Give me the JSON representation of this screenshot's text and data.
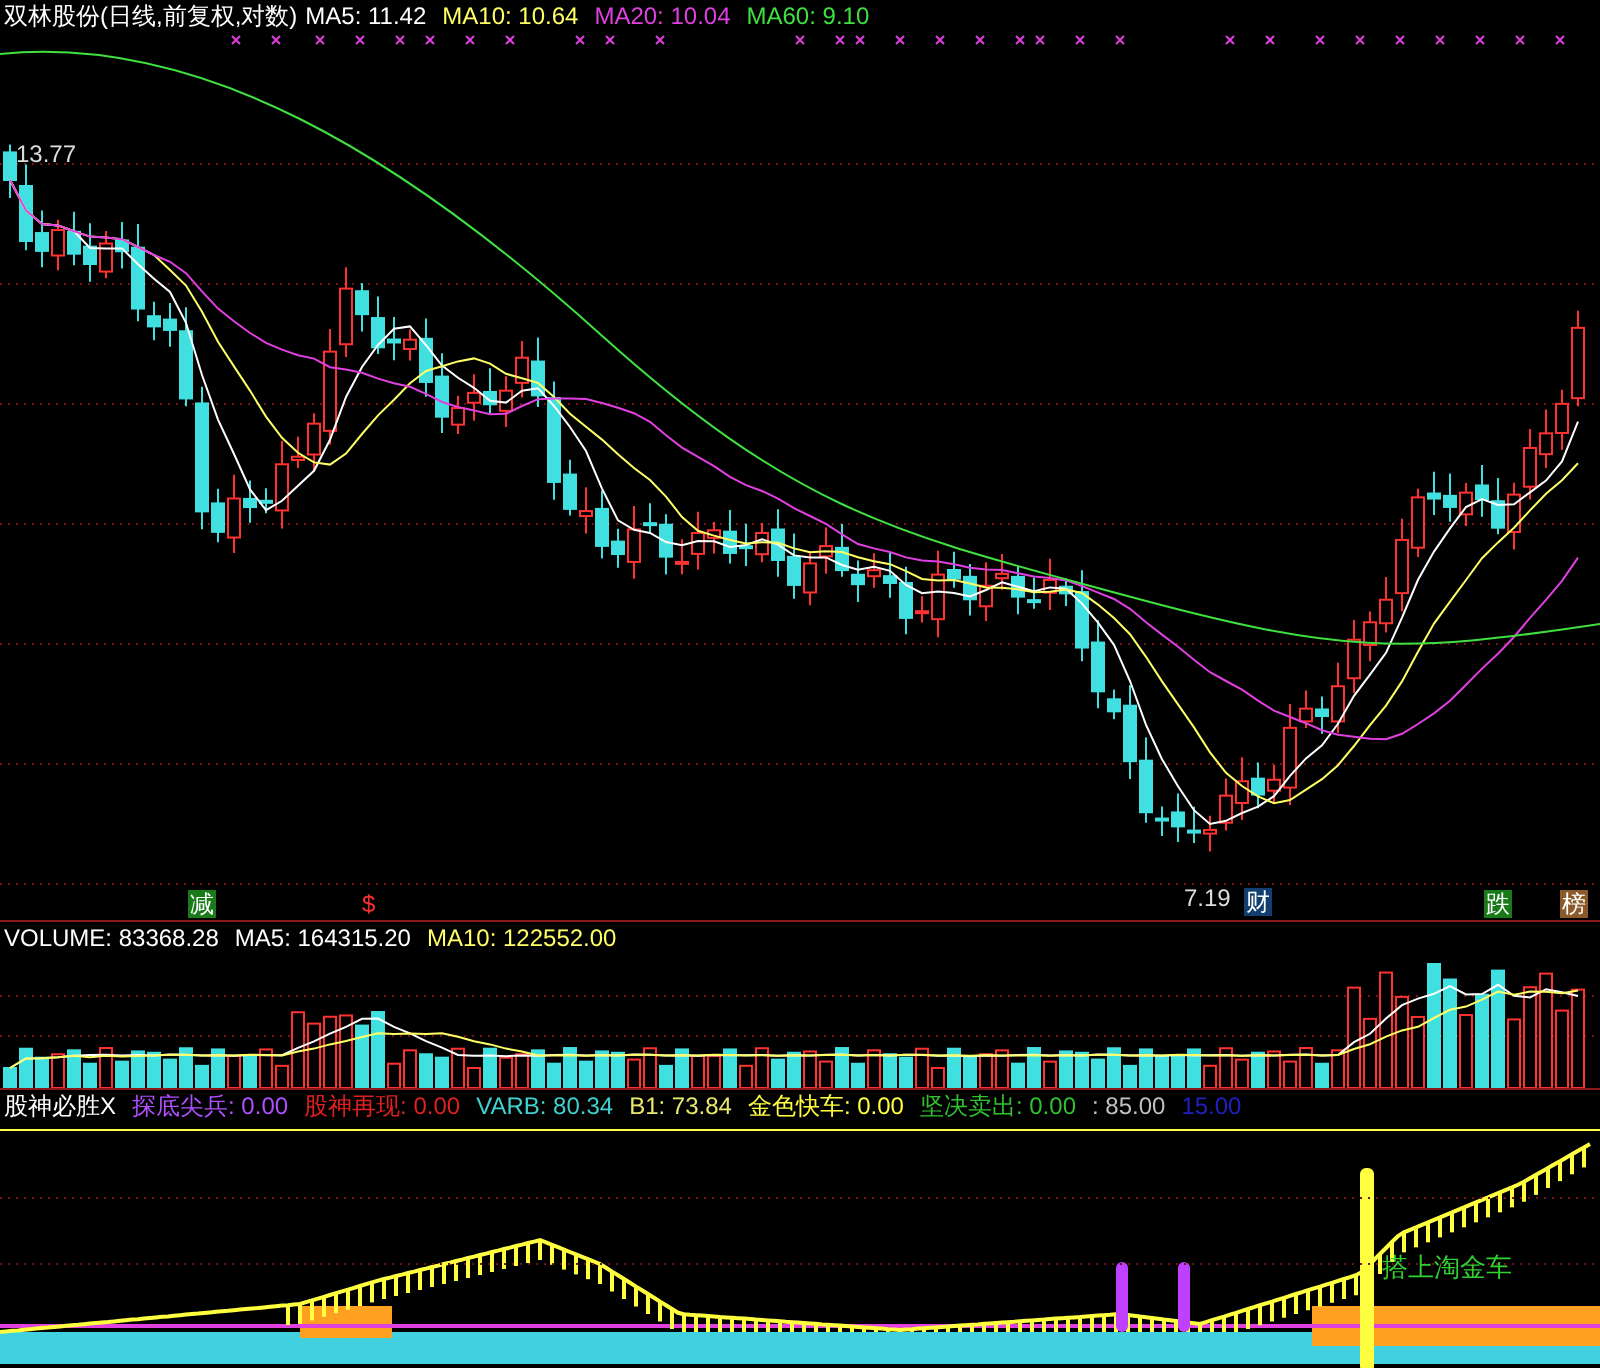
{
  "main_chart": {
    "title": "双林股份(日线,前复权,对数)",
    "indicators": [
      {
        "text": "MA5: 11.42",
        "color": "#ffffff"
      },
      {
        "text": "MA10: 10.64",
        "color": "#ffff66"
      },
      {
        "text": "MA20: 10.04",
        "color": "#e040e0"
      },
      {
        "text": "MA60: 9.10",
        "color": "#40e040"
      }
    ],
    "high_label": "13.77",
    "low_label": "7.19",
    "markers": [
      {
        "text": "减",
        "color": "#1a7a1a"
      },
      {
        "text": "$",
        "color": "#000000"
      },
      {
        "text": "财",
        "color": "#123e70"
      },
      {
        "text": "跌",
        "color": "#1a7a1a"
      },
      {
        "text": "榜",
        "color": "#8a5a2a"
      }
    ]
  },
  "volume_chart": {
    "indicators": [
      {
        "text": "VOLUME: 83368.28",
        "color": "#ffffff"
      },
      {
        "text": "MA5: 164315.20",
        "color": "#ffffff"
      },
      {
        "text": "MA10: 122552.00",
        "color": "#ffff66"
      }
    ]
  },
  "signal_chart": {
    "indicators": [
      {
        "text": "股神必胜X",
        "color": "#ffffff"
      },
      {
        "text": "探底尖兵: 0.00",
        "color": "#b050ff"
      },
      {
        "text": "股神再现: 0.00",
        "color": "#e02020"
      },
      {
        "text": "VARB: 80.34",
        "color": "#40d0d0"
      },
      {
        "text": "B1: 73.84",
        "color": "#e8e870"
      },
      {
        "text": "金色快车: 0.00",
        "color": "#ffff40"
      },
      {
        "text": "坚决卖出: 0.00",
        "color": "#30c030"
      },
      {
        "text": ": 85.00",
        "color": "#c0c0c0"
      },
      {
        "text": "15.00",
        "color": "#2020c0"
      }
    ],
    "annotation": "搭上淘金车"
  }
}
